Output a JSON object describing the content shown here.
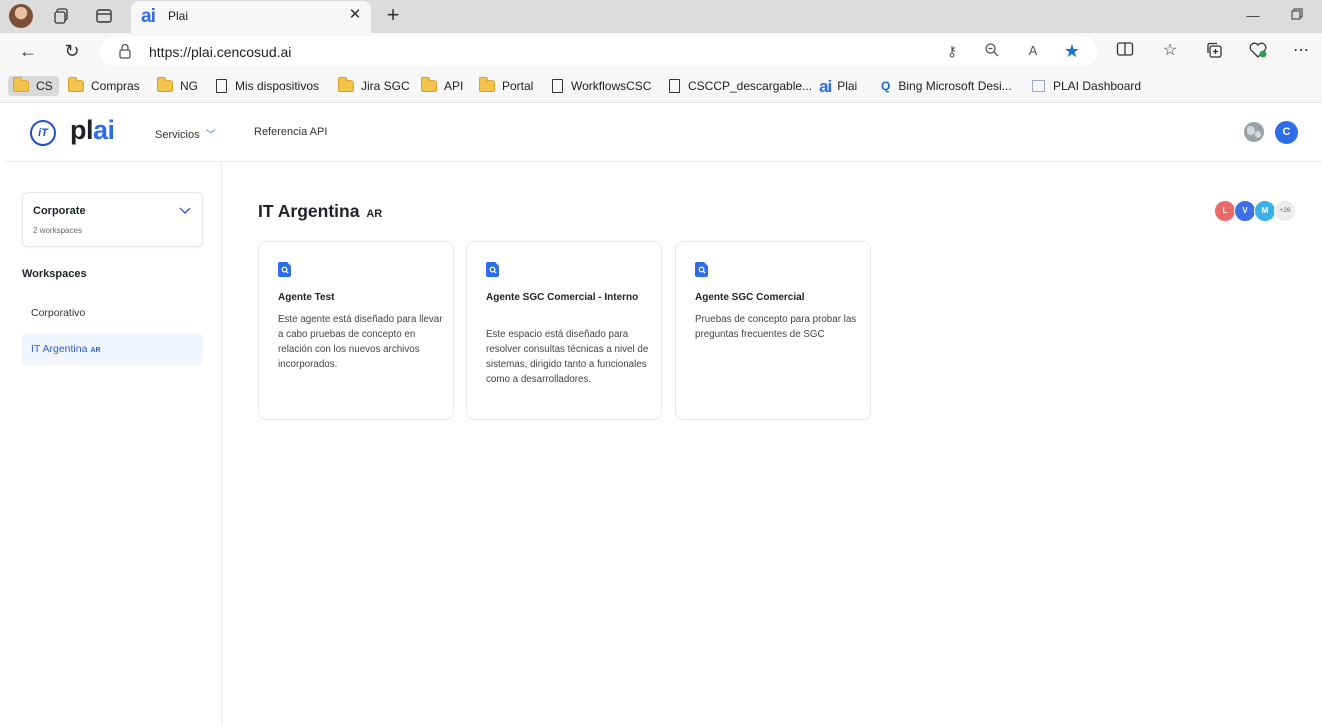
{
  "browser": {
    "tab_title": "Plai",
    "tab_logo": "ai",
    "url": "https://plai.cencosud.ai",
    "bookmarks": [
      {
        "label": "CS",
        "icon": "folder-icon"
      },
      {
        "label": "Compras",
        "icon": "folder-icon"
      },
      {
        "label": "NG",
        "icon": "folder-icon"
      },
      {
        "label": "Mis dispositivos",
        "icon": "page-icon"
      },
      {
        "label": "Jira SGC",
        "icon": "folder-icon"
      },
      {
        "label": "API",
        "icon": "folder-icon"
      },
      {
        "label": "Portal",
        "icon": "folder-icon"
      },
      {
        "label": "WorkflowsCSC",
        "icon": "page-icon"
      },
      {
        "label": "CSCCP_descargable...",
        "icon": "page-icon"
      },
      {
        "label": "Plai",
        "icon": "ai-logo-icon"
      },
      {
        "label": "Bing Microsoft Desi...",
        "icon": "search-icon"
      },
      {
        "label": "PLAI Dashboard",
        "icon": "dashboard-icon"
      }
    ]
  },
  "app": {
    "brand": {
      "mark": "iT",
      "word_prefix": "pl",
      "word_accent": "ai"
    },
    "nav": {
      "servicios": "Servicios",
      "referencia": "Referencia API"
    },
    "user_initial": "C"
  },
  "sidebar": {
    "org_name": "Corporate",
    "org_sub": "2 workspaces",
    "workspaces_title": "Workspaces",
    "items": [
      {
        "label": "Corporativo",
        "tag": ""
      },
      {
        "label": "IT Argentina",
        "tag": "AR"
      }
    ]
  },
  "main": {
    "title": "IT Argentina",
    "title_tag": "AR",
    "members": [
      {
        "initial": "L",
        "color": "#ea6a6a"
      },
      {
        "initial": "V",
        "color": "#3d6fe6"
      },
      {
        "initial": "M",
        "color": "#3ab0e6"
      }
    ],
    "members_more": "+26",
    "cards": [
      {
        "title": "Agente Test",
        "description": "Este agente está diseñado para llevar a cabo pruebas de concepto en relación con los nuevos archivos incorporados."
      },
      {
        "title": "Agente SGC Comercial - Interno",
        "description": "Este espacio está diseñado para resolver consultas técnicas a nivel de sistemas, dirigido tanto a funcionales como a desarrolladores."
      },
      {
        "title": "Agente SGC Comercial",
        "description": "Pruebas de concepto para probar las preguntas frecuentes de SGC"
      }
    ]
  },
  "colors": {
    "accent": "#2f6ce8",
    "brand_dark": "#1f4fd1",
    "active_bg": "#f0f5fe"
  }
}
